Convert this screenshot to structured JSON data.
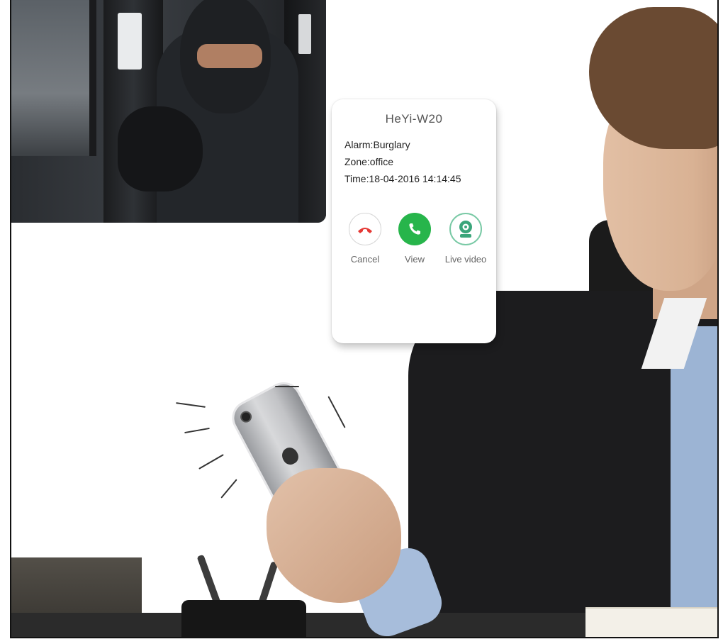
{
  "notification": {
    "device_name": "HeYi-W20",
    "alarm": "Alarm:Burglary",
    "zone": "Zone:office",
    "time": "Time:18-04-2016 14:14:45",
    "actions": {
      "cancel": {
        "label": "Cancel",
        "icon": "hangup-icon",
        "color": "#e53935"
      },
      "view": {
        "label": "View",
        "icon": "phone-icon",
        "color": "#27b54b"
      },
      "live": {
        "label": "Live video",
        "icon": "camera-icon",
        "color": "#3aa57a"
      }
    }
  }
}
